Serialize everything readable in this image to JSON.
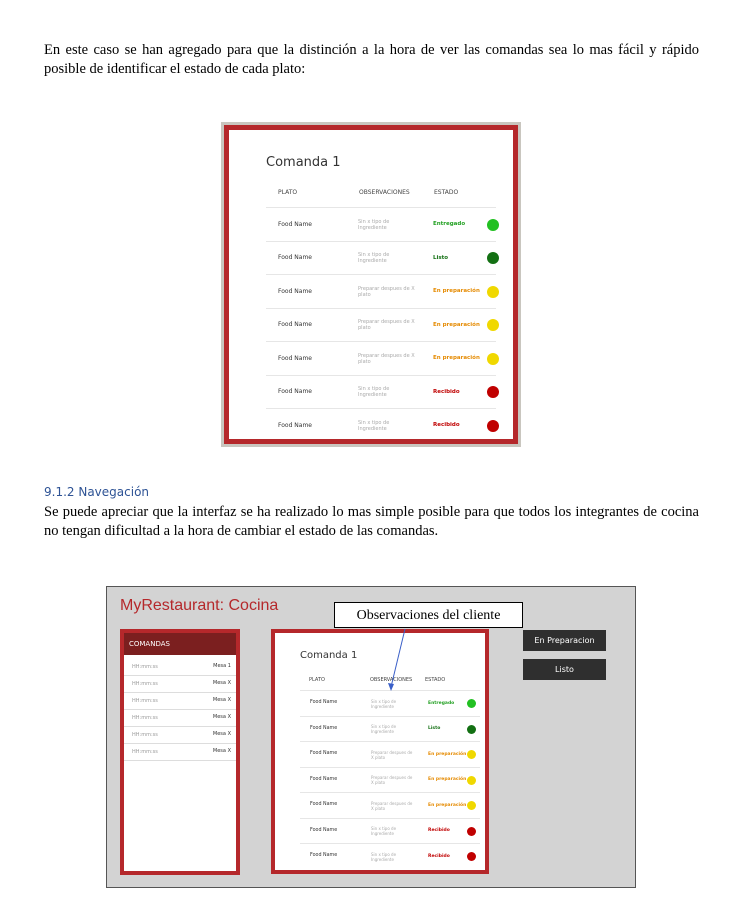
{
  "doc": {
    "intro": "En este caso se han agregado para que la distinción a la hora de ver las comandas sea lo mas fácil y rápido posible de identificar el estado de cada plato:",
    "heading": "9.1.2 Navegación",
    "nav_text": "Se puede apreciar que la interfaz se ha realizado lo mas simple posible para que todos los integrantes de cocina no tengan dificultad a la hora de cambiar el estado de las comandas."
  },
  "comanda": {
    "title": "Comanda 1",
    "headers": {
      "plato": "PLATO",
      "obs": "OBSERVACIONES",
      "estado": "ESTADO"
    },
    "rows": [
      {
        "plato": "Food Name",
        "obs": "Sin x tipo de Ingrediente",
        "estado": "Entregado",
        "color": "#22c022",
        "textcolor": "#22a022"
      },
      {
        "plato": "Food Name",
        "obs": "Sin x tipo de Ingrediente",
        "estado": "Listo",
        "color": "#137013",
        "textcolor": "#137013"
      },
      {
        "plato": "Food Name",
        "obs": "Preparar despues de X plato",
        "estado": "En preparación",
        "color": "#f0d800",
        "textcolor": "#e58a00"
      },
      {
        "plato": "Food Name",
        "obs": "Preparar despues de X plato",
        "estado": "En preparación",
        "color": "#f0d800",
        "textcolor": "#e58a00"
      },
      {
        "plato": "Food Name",
        "obs": "Preparar despues de X plato",
        "estado": "En preparación",
        "color": "#f0d800",
        "textcolor": "#e58a00"
      },
      {
        "plato": "Food Name",
        "obs": "Sin x tipo de Ingrediente",
        "estado": "Recibido",
        "color": "#c00000",
        "textcolor": "#c00000"
      },
      {
        "plato": "Food Name",
        "obs": "Sin x tipo de Ingrediente",
        "estado": "Recibido",
        "color": "#c00000",
        "textcolor": "#c00000"
      }
    ]
  },
  "app": {
    "title": "MyRestaurant: Cocina",
    "callout": "Observaciones del cliente",
    "sidebar_header": "COMANDAS",
    "sidebar_items": [
      {
        "time": "HH:mm:ss",
        "mesa": "Mesa 1"
      },
      {
        "time": "HH:mm:ss",
        "mesa": "Mesa X"
      },
      {
        "time": "HH:mm:ss",
        "mesa": "Mesa X"
      },
      {
        "time": "HH:mm:ss",
        "mesa": "Mesa X"
      },
      {
        "time": "HH:mm:ss",
        "mesa": "Mesa X"
      },
      {
        "time": "HH:mm:ss",
        "mesa": "Mesa X"
      }
    ],
    "btn_preparacion": "En Preparacion",
    "btn_listo": "Listo"
  },
  "colors": {
    "accent": "#b5282b",
    "sidebar_header": "#7b1f1f",
    "button": "#2f2f2f",
    "background": "#d3d3d3"
  }
}
